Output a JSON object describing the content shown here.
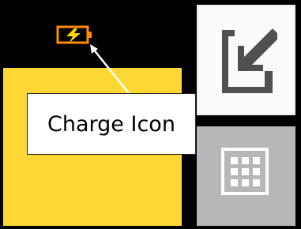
{
  "callout": {
    "label": "Charge Icon"
  },
  "icons": {
    "charge": "charge-icon",
    "top_button": "arrow-down-left-icon",
    "bottom_button": "grid-icon"
  },
  "colors": {
    "panel_yellow": "#fdd835",
    "charge_orange": "#ff8c00",
    "charge_bolt": "#ffd400",
    "button_light": "#fafafa",
    "button_gray": "#b9b6b9",
    "icon_gray": "#505050"
  }
}
